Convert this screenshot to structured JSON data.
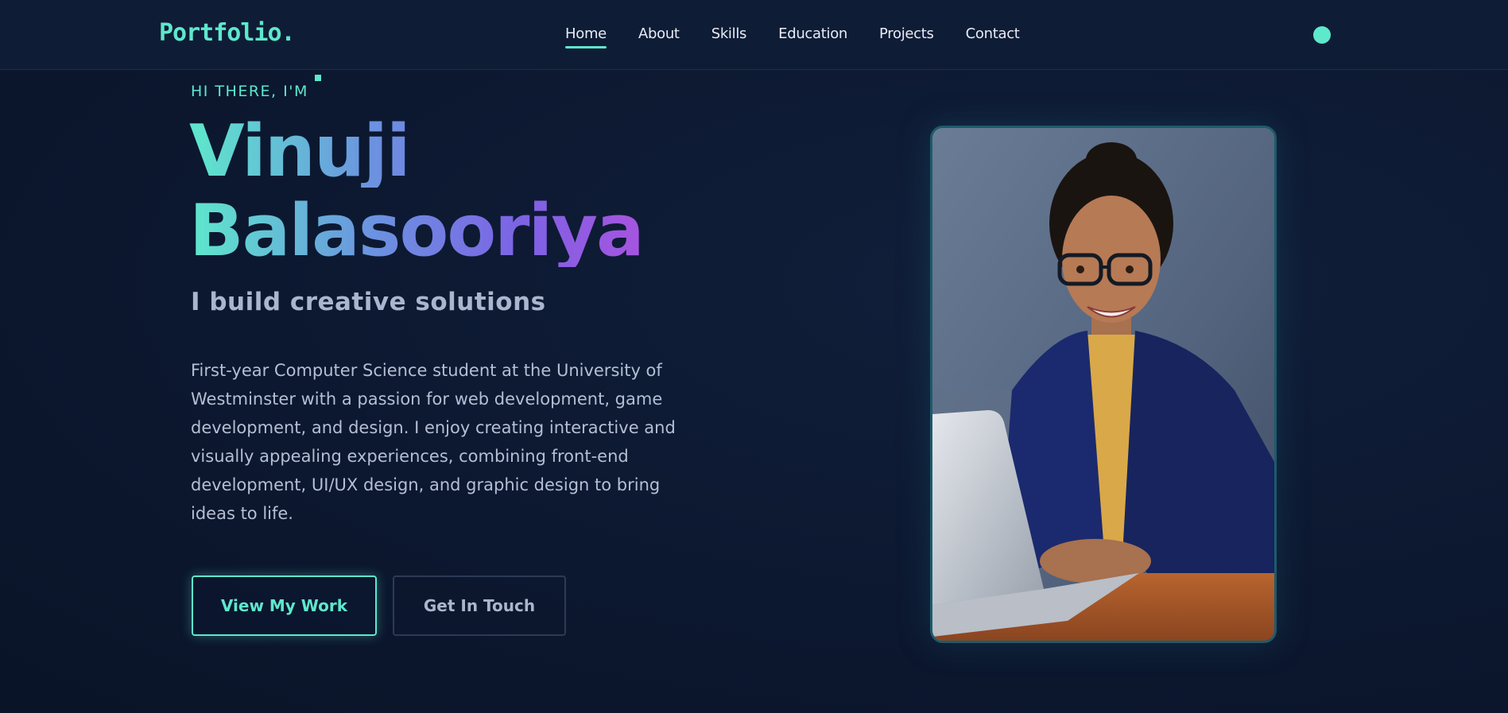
{
  "nav": {
    "logo": "Portfolio.",
    "links": [
      "Home",
      "About",
      "Skills",
      "Education",
      "Projects",
      "Contact"
    ],
    "active": "Home"
  },
  "hero": {
    "greeting": "HI THERE, I'M",
    "name_first": "Vinuji",
    "name_last": "Balasooriya",
    "tagline": "I build creative solutions",
    "bio": "First-year Computer Science student at the University of Westminster with a passion for web development, game development, and design. I enjoy creating interactive and visually appealing experiences, combining front-end development, UI/UX design, and graphic design to bring ideas to life.",
    "primary_button": "View My Work",
    "secondary_button": "Get In Touch"
  },
  "colors": {
    "accent": "#5ee8cc",
    "background": "#0c1830",
    "gradient_end": "#a455e0"
  },
  "icons": {
    "theme_toggle": "theme-toggle-icon"
  }
}
